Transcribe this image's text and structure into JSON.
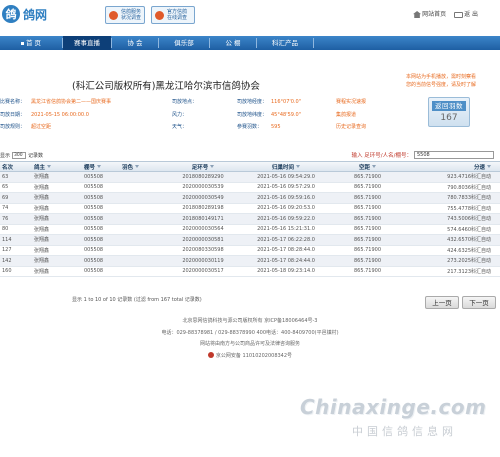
{
  "header": {
    "logo_mark": "鸽",
    "logo_text": "鸽网",
    "promo1": "信鸽服务 状况调查",
    "promo2": "官方信鸽 在线调查",
    "link_mail": "网站首页",
    "link_exit": "返 出"
  },
  "nav": {
    "items": [
      "首 页",
      "赛事直播",
      "协 会",
      "俱乐部",
      "公 棚",
      "科汇产品"
    ]
  },
  "title": "(科汇公司版权所有)黑龙江哈尔滨市信鸽协会",
  "notice": [
    "本网站为手机播放，需时刻察看",
    "您的当前信号强度，请及时了解"
  ],
  "info": {
    "rows": [
      [
        {
          "label": "比赛名称：",
          "value": "黑龙江省信鸽协会第二——国庆赛事"
        },
        {
          "label": "司放地点：",
          "value": ""
        },
        {
          "label": "司放地经度：",
          "value": "116°07'0.0\""
        },
        {
          "label": "",
          "value": "赛程实况速报"
        }
      ],
      [
        {
          "label": "司放日期：",
          "value": "2021-05-15 06:00:00.0"
        },
        {
          "label": "风力：",
          "value": ""
        },
        {
          "label": "司放地纬度：",
          "value": "45°48'59.0\""
        },
        {
          "label": "",
          "value": "集鸽报道"
        }
      ],
      [
        {
          "label": "司放规则：",
          "value": "超过空距"
        },
        {
          "label": "天气：",
          "value": ""
        },
        {
          "label": "参赛羽数：",
          "value": "595"
        },
        {
          "label": "",
          "value": "历史记录查询"
        }
      ]
    ]
  },
  "countdown": {
    "title": "返回羽数",
    "value": "167"
  },
  "controls": {
    "show_label": "显示",
    "show_value": "300",
    "show_suffix": "记录数",
    "search_label": "输入 足环号/人名/棚号：",
    "search_value": "5508"
  },
  "table": {
    "headers": [
      "名次",
      "鸽主",
      "棚号",
      "羽色",
      "足环号",
      "归巢时间",
      "空距",
      "分速"
    ],
    "rows": [
      [
        "63",
        "张翔鑫",
        "005508",
        "",
        "2018080289290",
        "2021-05-16 09:54:29.0",
        "865.71900",
        "923.4716科汇自动"
      ],
      [
        "65",
        "张翔鑫",
        "005508",
        "",
        "2020000030539",
        "2021-05-16 09:57:29.0",
        "865.71900",
        "790.8036科汇自动"
      ],
      [
        "69",
        "张翔鑫",
        "005508",
        "",
        "2020000030549",
        "2021-05-16 09:59:16.0",
        "865.71900",
        "780.7833科汇自动"
      ],
      [
        "74",
        "张翔鑫",
        "005508",
        "",
        "2018080289198",
        "2021-05-16 09:20:53.0",
        "865.71900",
        "755.4778科汇自动"
      ],
      [
        "76",
        "张翔鑫",
        "005508",
        "",
        "2018080149171",
        "2021-05-16 09:59:22.0",
        "865.71900",
        "743.5006科汇自动"
      ],
      [
        "80",
        "张翔鑫",
        "005508",
        "",
        "2020000030564",
        "2021-05-16 15:21:31.0",
        "865.71900",
        "574.6460科汇自动"
      ],
      [
        "114",
        "张翔鑫",
        "005508",
        "",
        "2020000030581",
        "2021-05-17 06:22:28.0",
        "865.71900",
        "432.6570科汇自动"
      ],
      [
        "127",
        "张翔鑫",
        "005508",
        "",
        "2020080330598",
        "2021-05-17 08:28:44.0",
        "865.71900",
        "424.6325科汇自动"
      ],
      [
        "142",
        "张翔鑫",
        "005508",
        "",
        "2020000030119",
        "2021-05-17 08:24:44.0",
        "865.71900",
        "273.2025科汇自动"
      ],
      [
        "160",
        "张翔鑫",
        "005508",
        "",
        "2020000030517",
        "2021-05-18 09:23:14.0",
        "865.71900",
        "217.3123科汇自动"
      ]
    ]
  },
  "summary": "显示 1 to 10 of 10 记录数 (过滤 from 167 total 记录数)",
  "pager": {
    "prev": "上一页",
    "next": "下一页"
  },
  "footer": {
    "lines": [
      "北京思网信鸽科技与源公司版权所有 京ICP备18006464号-3",
      "电话：029-88378981 / 029-88378990   400电话：400-8409700(平邑镇村)",
      "网站将由南方与公司商品许可及法律咨询服务"
    ],
    "police": "京公网安备 11010202008342号"
  },
  "watermark": {
    "en": "Chinaxinge.com",
    "cn": "中国信鸽信息网"
  }
}
